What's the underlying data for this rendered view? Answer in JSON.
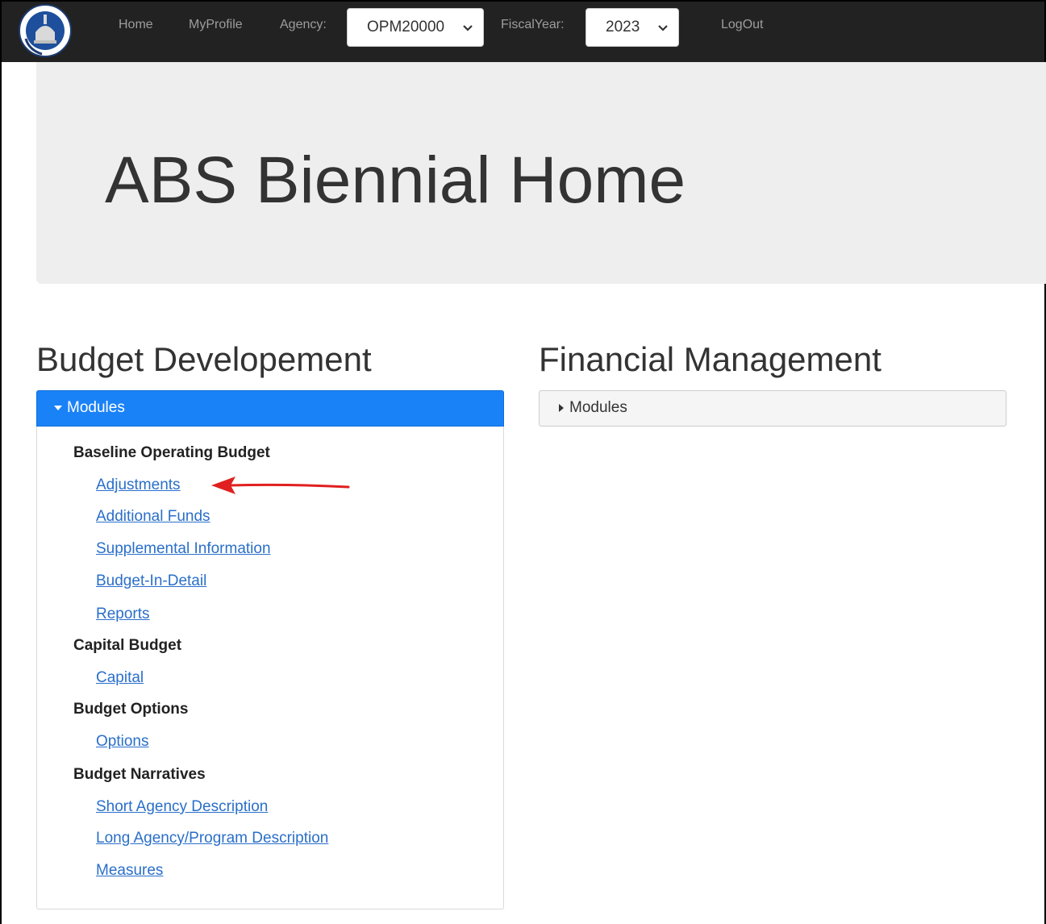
{
  "navbar": {
    "logo_alt": "Office of Policy and Management seal",
    "home": "Home",
    "myprofile": "MyProfile",
    "agency_label": "Agency:",
    "agency_value": "OPM20000",
    "fiscal_label": "FiscalYear:",
    "fiscal_value": "2023",
    "logout": "LogOut"
  },
  "jumbotron": {
    "title": "ABS Biennial Home"
  },
  "budget_dev": {
    "heading": "Budget Developement",
    "panel_label": "Modules",
    "groups": [
      {
        "title": "Baseline Operating Budget",
        "links": [
          "Adjustments",
          "Additional Funds",
          "Supplemental Information",
          "Budget-In-Detail",
          "Reports"
        ]
      },
      {
        "title": "Capital Budget",
        "links": [
          "Capital"
        ]
      },
      {
        "title": "Budget Options",
        "links": [
          "Options"
        ]
      },
      {
        "title": "Budget Narratives",
        "links": [
          "Short Agency Description",
          "Long Agency/Program Description",
          "Measures"
        ]
      }
    ]
  },
  "financial": {
    "heading": "Financial Management",
    "panel_label": "Modules"
  },
  "colors": {
    "navbar": "#222222",
    "accent": "#1a82f7",
    "link": "#2a6fc9",
    "annotation_arrow": "#e02020"
  },
  "icons": {
    "caret_down": "caret-down-icon",
    "caret_right": "caret-right-icon",
    "select_chevron": "chevron-down-icon",
    "annotation": "red-arrow-icon"
  }
}
